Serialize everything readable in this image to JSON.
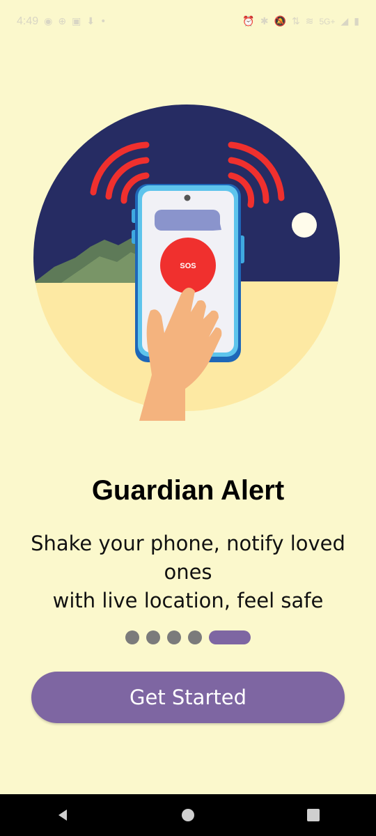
{
  "status_bar": {
    "time": "4:49",
    "network": "5G+"
  },
  "illustration": {
    "sos_label": "SOS",
    "colors": {
      "sky": "#262C63",
      "sand": "#FDE9A3",
      "waves": "#F0302E",
      "phone_frame": "#1E67B8",
      "sos_button": "#F0302E"
    }
  },
  "onboarding": {
    "title": "Guardian Alert",
    "subtitle_line1": "Shake your phone, notify loved ones",
    "subtitle_line2": "with live location, feel safe",
    "page_indicator": {
      "total": 5,
      "current": 5
    },
    "cta_label": "Get Started"
  },
  "nav_bar": {
    "back": "back-icon",
    "home": "home-icon",
    "recents": "recents-icon"
  }
}
